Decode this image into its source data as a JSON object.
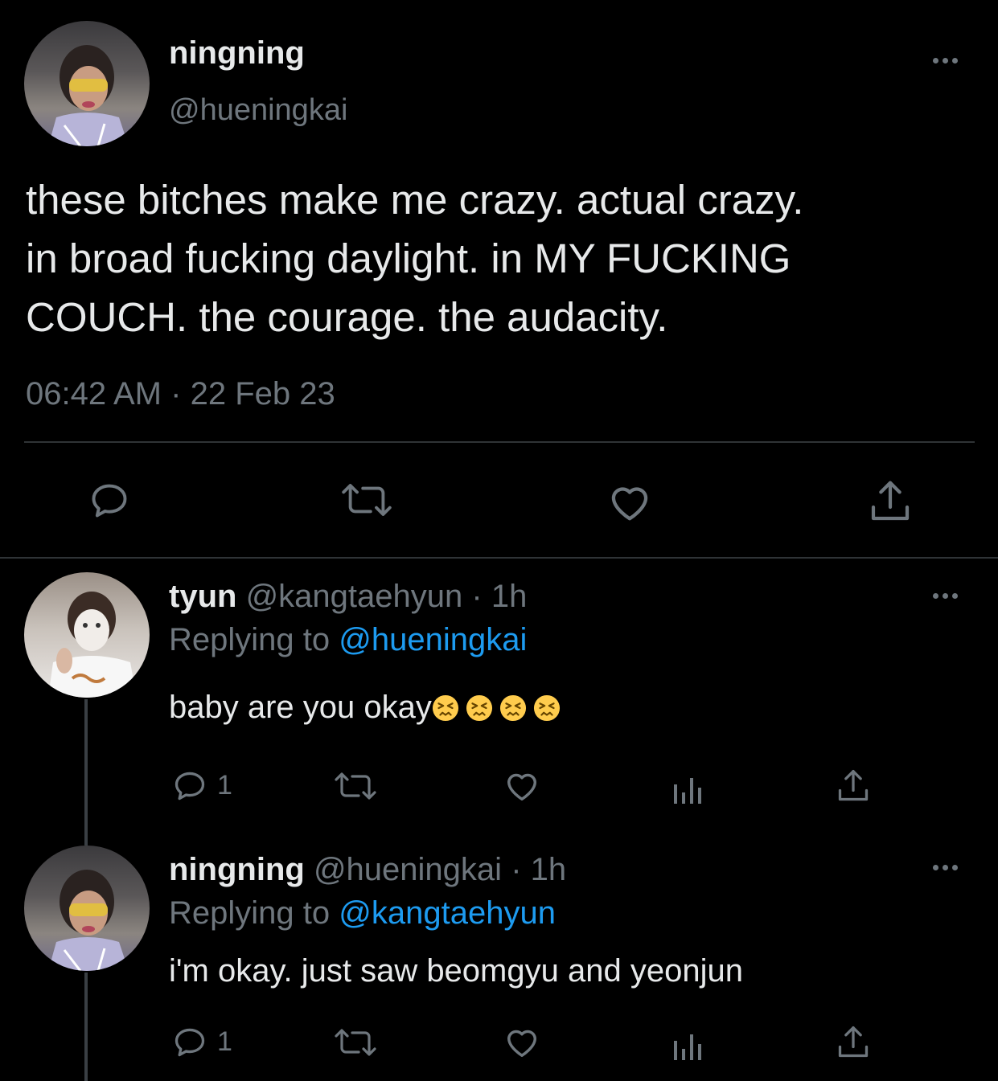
{
  "main_tweet": {
    "display_name": "ningning",
    "handle": "@hueningkai",
    "text_lines": [
      "these bitches make me crazy. actual crazy.",
      "in broad fucking daylight. in MY FUCKING",
      "COUCH. the courage. the audacity."
    ],
    "time": "06:42 AM",
    "separator": "·",
    "date": "22 Feb 23"
  },
  "replies": [
    {
      "display_name": "tyun",
      "handle": "@kangtaehyun",
      "time": "1h",
      "separator": "·",
      "replying_label": "Replying to",
      "replying_handle": "@hueningkai",
      "text": "baby are you okay",
      "emoji_count": 4,
      "reply_count": "1"
    },
    {
      "display_name": "ningning",
      "handle": "@hueningkai",
      "time": "1h",
      "separator": "·",
      "replying_label": "Replying to",
      "replying_handle": "@kangtaehyun",
      "text": "i'm okay. just saw beomgyu and yeonjun",
      "reply_count": "1"
    }
  ],
  "icons": {
    "reply": "reply-icon",
    "retweet": "retweet-icon",
    "like": "heart-icon",
    "share": "share-icon",
    "analytics": "analytics-icon",
    "more": "more-icon",
    "emoji": "persevering-face-emoji"
  },
  "colors": {
    "background": "#000000",
    "text": "#e7e9ea",
    "muted": "#6e767d",
    "link": "#1d9bf0",
    "divider": "#2f3336"
  }
}
